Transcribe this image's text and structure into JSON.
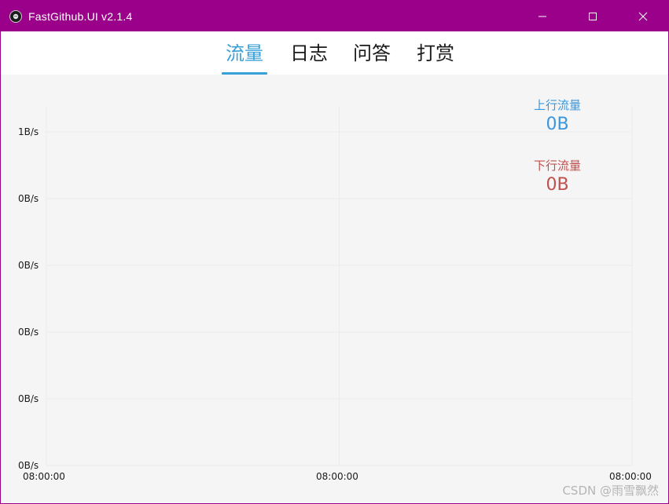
{
  "window": {
    "title": "FastGithub.UI v2.1.4",
    "accent_color": "#9a0089",
    "icons": {
      "app": "github-cat-icon",
      "minimize": "minimize-icon",
      "maximize": "maximize-icon",
      "close": "close-icon"
    }
  },
  "tabs": [
    {
      "label": "流量",
      "active": true
    },
    {
      "label": "日志",
      "active": false
    },
    {
      "label": "问答",
      "active": false
    },
    {
      "label": "打赏",
      "active": false
    }
  ],
  "tab_active_color": "#3aa1d8",
  "legend": {
    "upload": {
      "label": "上行流量",
      "value": "0B",
      "color": "#3a96dd"
    },
    "download": {
      "label": "下行流量",
      "value": "0B",
      "color": "#c0504d"
    }
  },
  "chart_data": {
    "type": "line",
    "y_tick_labels": [
      "1B/s",
      "0B/s",
      "0B/s",
      "0B/s",
      "0B/s",
      "0B/s"
    ],
    "x_tick_labels": [
      "08:00:00",
      "08:00:00",
      "08:00:00"
    ],
    "series": [
      {
        "name": "上行流量",
        "values": []
      },
      {
        "name": "下行流量",
        "values": []
      }
    ],
    "grid": true
  },
  "watermark": "CSDN @雨雪飘然"
}
